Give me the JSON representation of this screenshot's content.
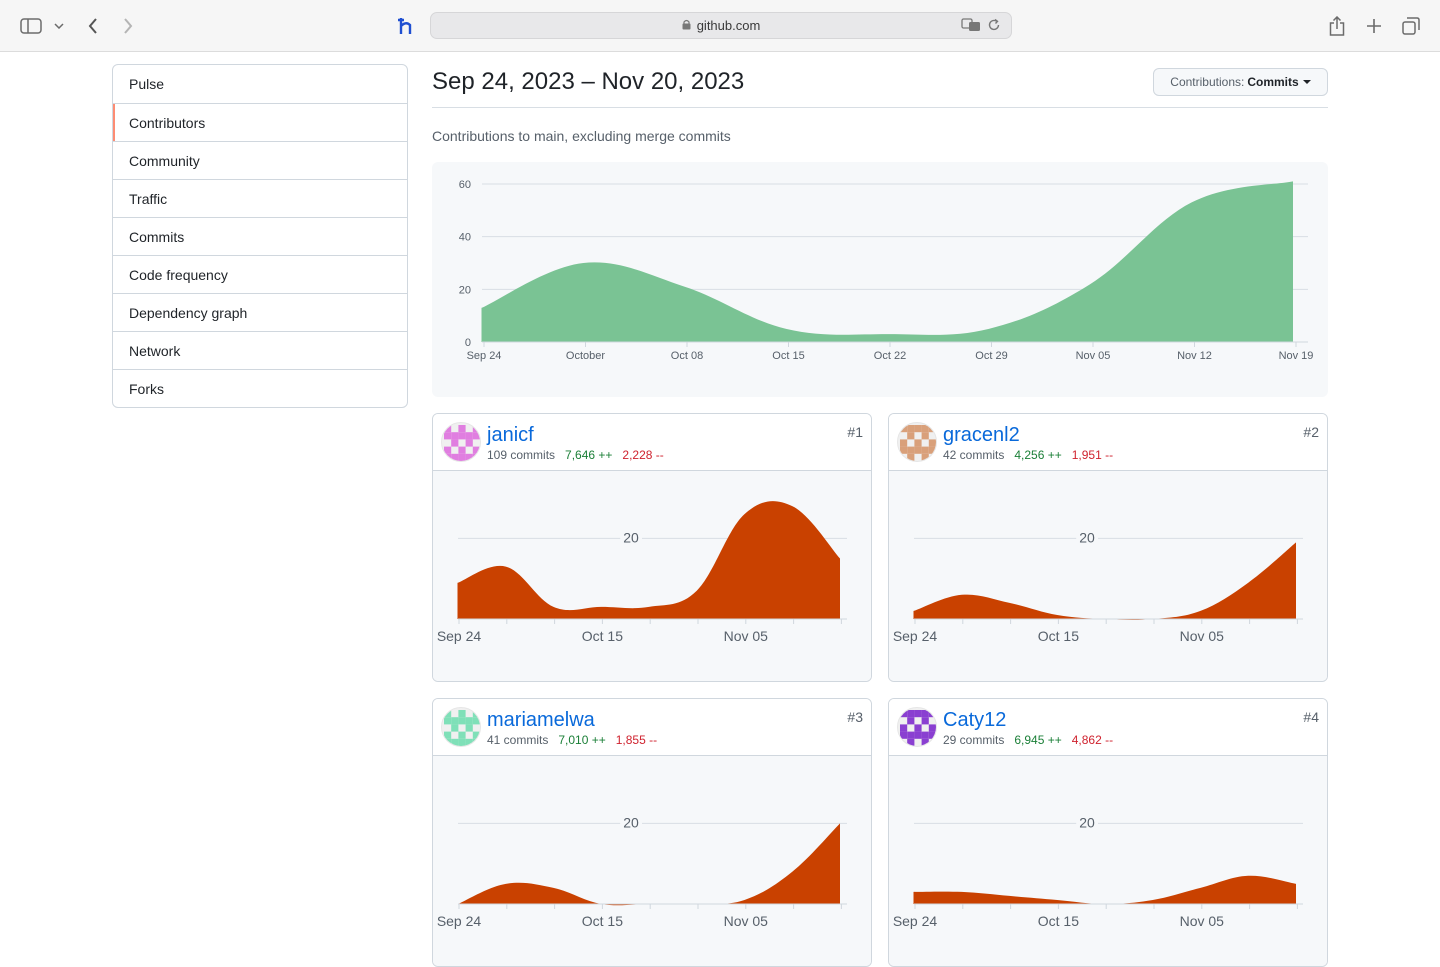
{
  "browser": {
    "url": "github.com"
  },
  "sidebar": {
    "items": [
      {
        "label": "Pulse"
      },
      {
        "label": "Contributors"
      },
      {
        "label": "Community"
      },
      {
        "label": "Traffic"
      },
      {
        "label": "Commits"
      },
      {
        "label": "Code frequency"
      },
      {
        "label": "Dependency graph"
      },
      {
        "label": "Network"
      },
      {
        "label": "Forks"
      }
    ],
    "active": "Contributors"
  },
  "header": {
    "range": "Sep 24, 2023 – Nov 20, 2023",
    "select_prefix": "Contributions:",
    "select_value": "Commits",
    "subtitle": "Contributions to main, excluding merge commits"
  },
  "colors": {
    "main_area": "#7ac394",
    "contrib_area": "#c94100",
    "link": "#0969da",
    "additions": "#1a7f37",
    "deletions": "#cf222e",
    "active_marker": "#fd8c73"
  },
  "chart_data": [
    {
      "type": "area",
      "x": [
        "Sep 24",
        "Oct 01",
        "Oct 08",
        "Oct 15",
        "Oct 22",
        "Oct 29",
        "Nov 05",
        "Nov 12",
        "Nov 19"
      ],
      "x_tick_labels": [
        "Sep 24",
        "October",
        "Oct 08",
        "Oct 15",
        "Oct 22",
        "Oct 29",
        "Nov 05",
        "Nov 12",
        "Nov 19"
      ],
      "values": [
        13,
        30,
        21,
        5,
        3,
        5,
        22,
        53,
        61
      ],
      "y_ticks": [
        0,
        20,
        40,
        60
      ],
      "ylim": [
        0,
        60
      ],
      "grid": true
    },
    {
      "type": "area",
      "contributor": "janicf",
      "x": [
        "Sep 24",
        "Oct 01",
        "Oct 08",
        "Oct 15",
        "Oct 22",
        "Oct 29",
        "Nov 05",
        "Nov 12",
        "Nov 19"
      ],
      "x_tick_labels": [
        "Sep 24",
        "Oct 15",
        "Nov 05"
      ],
      "values": [
        9,
        13,
        3,
        3,
        3,
        7,
        26,
        28,
        15
      ],
      "y_ticks": [
        20
      ],
      "ylim": [
        0,
        30
      ]
    },
    {
      "type": "area",
      "contributor": "gracenl2",
      "x": [
        "Sep 24",
        "Oct 01",
        "Oct 08",
        "Oct 15",
        "Oct 22",
        "Oct 29",
        "Nov 05",
        "Nov 12",
        "Nov 19"
      ],
      "x_tick_labels": [
        "Sep 24",
        "Oct 15",
        "Nov 05"
      ],
      "values": [
        2,
        6,
        4,
        1,
        0,
        0,
        2,
        9,
        19
      ],
      "y_ticks": [
        20
      ],
      "ylim": [
        0,
        30
      ]
    },
    {
      "type": "area",
      "contributor": "mariamelwa",
      "x": [
        "Sep 24",
        "Oct 01",
        "Oct 08",
        "Oct 15",
        "Oct 22",
        "Oct 29",
        "Nov 05",
        "Nov 12",
        "Nov 19"
      ],
      "x_tick_labels": [
        "Sep 24",
        "Oct 15",
        "Nov 05"
      ],
      "values": [
        0,
        5,
        4,
        0,
        0,
        0,
        1,
        8,
        20
      ],
      "y_ticks": [
        20
      ],
      "ylim": [
        0,
        30
      ]
    },
    {
      "type": "area",
      "contributor": "Caty12",
      "x": [
        "Sep 24",
        "Oct 01",
        "Oct 08",
        "Oct 15",
        "Oct 22",
        "Oct 29",
        "Nov 05",
        "Nov 12",
        "Nov 19"
      ],
      "x_tick_labels": [
        "Sep 24",
        "Oct 15",
        "Nov 05"
      ],
      "values": [
        3,
        3,
        2,
        1,
        0,
        1,
        4,
        7,
        5
      ],
      "y_ticks": [
        20
      ],
      "ylim": [
        0,
        30
      ]
    }
  ],
  "contributors": [
    {
      "name": "janicf",
      "commits": "109 commits",
      "additions": "7,646 ++",
      "deletions": "2,228 --",
      "rank": "#1",
      "avatar_color": "#e07ee0"
    },
    {
      "name": "gracenl2",
      "commits": "42 commits",
      "additions": "4,256 ++",
      "deletions": "1,951 --",
      "rank": "#2",
      "avatar_color": "#d9a07a"
    },
    {
      "name": "mariamelwa",
      "commits": "41 commits",
      "additions": "7,010 ++",
      "deletions": "1,855 --",
      "rank": "#3",
      "avatar_color": "#7fe0b8"
    },
    {
      "name": "Caty12",
      "commits": "29 commits",
      "additions": "6,945 ++",
      "deletions": "4,862 --",
      "rank": "#4",
      "avatar_color": "#8a3fd1"
    }
  ]
}
